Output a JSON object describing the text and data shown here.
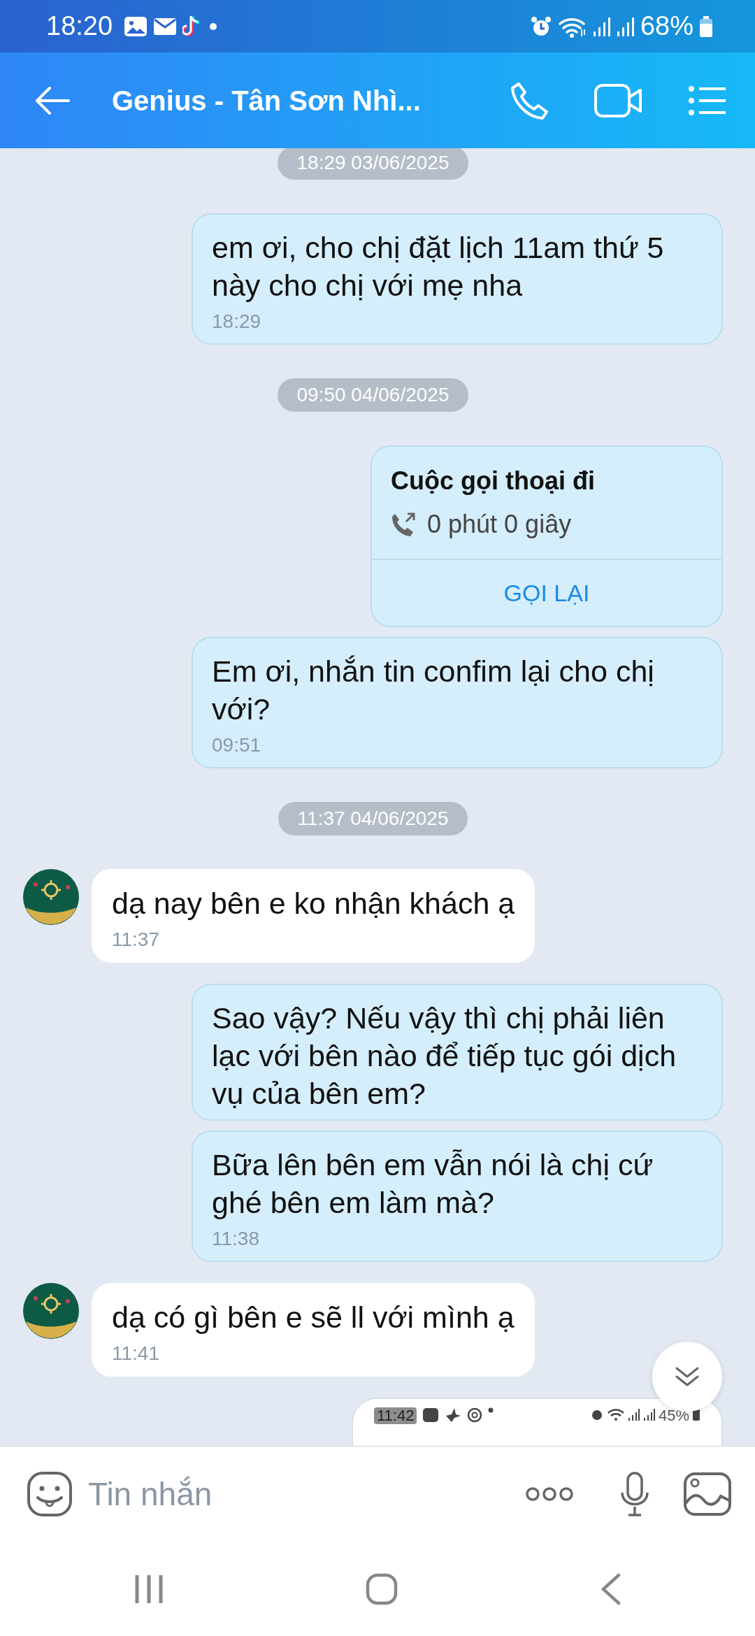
{
  "status_bar": {
    "time": "18:20",
    "battery": "68%"
  },
  "header": {
    "title": "Genius - Tân Sơn Nhì..."
  },
  "messages": [
    {
      "kind": "date",
      "text": "18:29 03/06/2025"
    },
    {
      "kind": "text",
      "outgoing": true,
      "text": "em ơi, cho chị đặt lịch 11am thứ 5 này cho chị với mẹ nha",
      "time": "18:29"
    },
    {
      "kind": "date",
      "text": "09:50 04/06/2025"
    },
    {
      "kind": "call",
      "outgoing": true,
      "title": "Cuộc gọi thoại đi",
      "duration": "0 phút 0 giây",
      "action": "GỌI LẠI"
    },
    {
      "kind": "text",
      "outgoing": true,
      "text": "Em ơi, nhắn tin confim lại cho chị với?",
      "time": "09:51"
    },
    {
      "kind": "date",
      "text": "11:37 04/06/2025"
    },
    {
      "kind": "text",
      "outgoing": false,
      "text": "dạ nay bên e ko nhận khách ạ",
      "time": "11:37"
    },
    {
      "kind": "text",
      "outgoing": true,
      "text": "Sao vậy? Nếu vậy thì chị phải liên lạc với bên nào để tiếp tục gói dịch vụ của bên em?"
    },
    {
      "kind": "text",
      "outgoing": true,
      "text": "Bữa lên bên em vẫn nói là chị cứ ghé bên em làm mà?",
      "time": "11:38"
    },
    {
      "kind": "text",
      "outgoing": false,
      "text": "dạ có gì bên e sẽ ll với mình ạ",
      "time": "11:41"
    },
    {
      "kind": "image",
      "outgoing": true,
      "shot_time": "11:42",
      "shot_battery": "45%"
    }
  ],
  "composer": {
    "placeholder": "Tin nhắn"
  }
}
